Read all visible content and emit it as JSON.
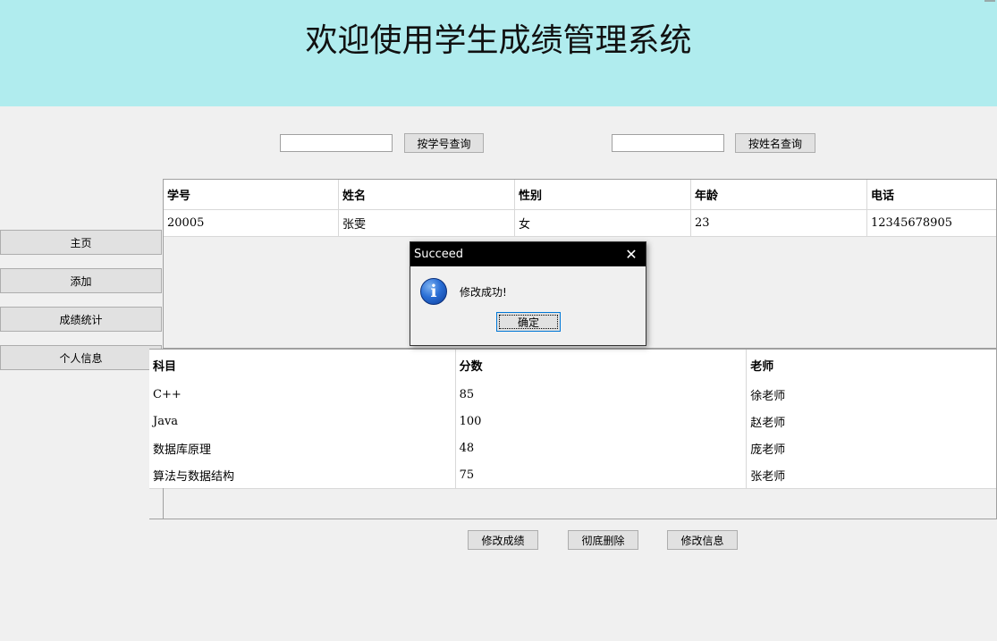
{
  "header": {
    "title": "欢迎使用学生成绩管理系统"
  },
  "search": {
    "by_id_value": "",
    "by_id_button": "按学号查询",
    "by_name_value": "",
    "by_name_button": "按姓名查询"
  },
  "sidebar": {
    "items": [
      {
        "label": "主页"
      },
      {
        "label": "添加"
      },
      {
        "label": "成绩统计"
      },
      {
        "label": "个人信息"
      }
    ]
  },
  "student_table": {
    "columns": [
      "学号",
      "姓名",
      "性别",
      "年龄",
      "电话"
    ],
    "rows": [
      [
        "20005",
        "张雯",
        "女",
        "23",
        "12345678905"
      ]
    ]
  },
  "grades_table": {
    "columns": [
      "科目",
      "分数",
      "老师"
    ],
    "rows": [
      [
        "C++",
        "85",
        "徐老师"
      ],
      [
        "Java",
        "100",
        "赵老师"
      ],
      [
        "数据库原理",
        "48",
        "庞老师"
      ],
      [
        "算法与数据结构",
        "75",
        "张老师"
      ]
    ]
  },
  "actions": {
    "edit_grades": "修改成绩",
    "delete_all": "彻底删除",
    "edit_info": "修改信息"
  },
  "dialog": {
    "title": "Succeed",
    "close_symbol": "✕",
    "icon_symbol": "i",
    "message": "修改成功!",
    "ok_label": "确定"
  }
}
